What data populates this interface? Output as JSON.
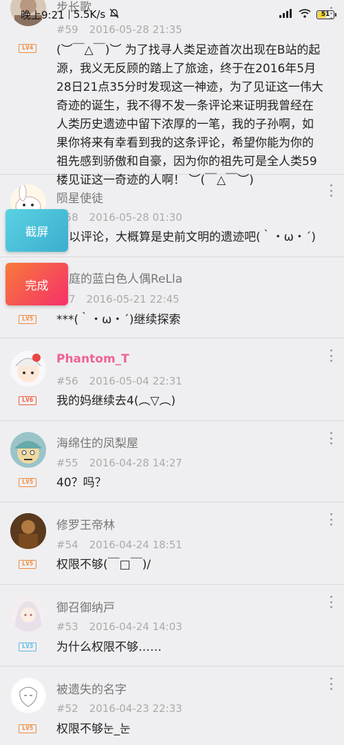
{
  "status_bar": {
    "time": "晚上9:21",
    "speed": "5.5K/s",
    "battery": "51"
  },
  "floating_buttons": {
    "screenshot": "截屏",
    "done": "完成"
  },
  "comments": [
    {
      "username": "步长歌",
      "floor": "#59",
      "date": "2016-05-28 21:35",
      "level": "LV4",
      "text": "(︶￣△￣)︶ 为了找寻人类足迹首次出现在B站的起源，我义无反顾的踏上了旅途，终于在2016年5月28日21点35分时发现这一神迹，为了见证这一伟大奇迹的诞生，我不得不发一条评论来证明我曾经在人类历史遗迹中留下浓厚的一笔，我的子孙啊，如果你将来有幸看到我的这条评论，希望你能为你的祖先感到骄傲和自豪，因为你的祖先可是全人类59楼见证这一奇迹的人啊！ ︶(￣△￣︶)"
    },
    {
      "username": "陨星使徒",
      "floor": "#58",
      "date": "2016-05-28 01:30",
      "level": "",
      "text": "以评论，大概算是史前文明的遗迹吧(｀・ω・´)"
    },
    {
      "username": "庭的蓝白色人偶ReLla",
      "floor": "7",
      "date": "2016-05-21 22:45",
      "level": "LV5",
      "text": "***(｀・ω・´)继续探索"
    },
    {
      "username": "Phantom_T",
      "floor": "#56",
      "date": "2016-05-04 22:31",
      "level": "LV6",
      "text": "我的妈继续去4(︵▽︵)"
    },
    {
      "username": "海绵住的凤梨屋",
      "floor": "#55",
      "date": "2016-04-28 14:27",
      "level": "LV5",
      "text": "40？吗？"
    },
    {
      "username": "修罗王帝林",
      "floor": "#54",
      "date": "2016-04-24 18:51",
      "level": "LV5",
      "text": "权限不够(￣□￣)/"
    },
    {
      "username": "御召御纳戸",
      "floor": "#53",
      "date": "2016-04-24 14:03",
      "level": "LV3",
      "text": "为什么权限不够……"
    },
    {
      "username": "被遗失的名字",
      "floor": "#52",
      "date": "2016-04-23 22:33",
      "level": "LV5",
      "text": "权限不够눈_눈"
    }
  ]
}
